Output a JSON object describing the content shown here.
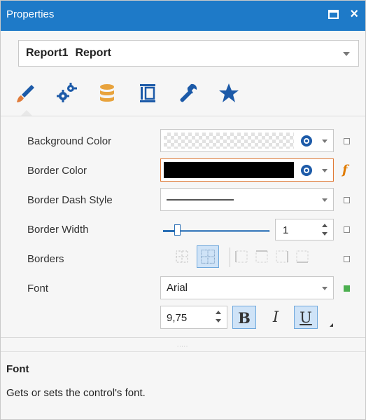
{
  "window": {
    "title": "Properties",
    "accent_color": "#1e7ac8"
  },
  "object_selector": {
    "name": "Report1",
    "type": "Report"
  },
  "tabs": [
    {
      "icon": "brush-icon"
    },
    {
      "icon": "gears-icon"
    },
    {
      "icon": "database-icon"
    },
    {
      "icon": "layout-icon"
    },
    {
      "icon": "wrench-icon"
    },
    {
      "icon": "star-icon"
    }
  ],
  "properties": {
    "background_color": {
      "label": "Background Color",
      "value_color": "transparent"
    },
    "border_color": {
      "label": "Border Color",
      "value_color": "#000000"
    },
    "border_dash_style": {
      "label": "Border Dash Style",
      "value": "solid"
    },
    "border_width": {
      "label": "Border Width",
      "value": "1"
    },
    "borders": {
      "label": "Borders"
    },
    "font": {
      "label": "Font",
      "family": "Arial",
      "size": "9,75",
      "bold_label": "B",
      "italic_label": "I",
      "underline_label": "U"
    }
  },
  "description": {
    "title": "Font",
    "text": "Gets or sets the control's font."
  }
}
